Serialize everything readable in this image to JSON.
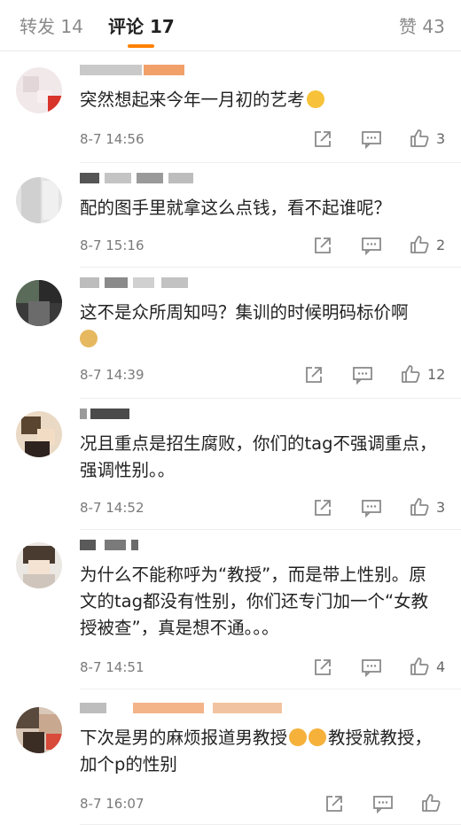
{
  "tabs": {
    "repost": "转发 14",
    "comments": "评论 17",
    "likes": "赞 43"
  },
  "accent_color": "#ff8200",
  "comments": [
    {
      "text": "突然想起来今年一月初的艺考",
      "time": "8-7 14:56",
      "likes": "3",
      "emoji": "yum-face-emoji"
    },
    {
      "text": "配的图手里就拿这么点钱，看不起谁呢？",
      "time": "8-7 15:16",
      "likes": "2"
    },
    {
      "text": "这不是众所周知吗？集训的时候明码标价啊",
      "time": "8-7 14:39",
      "likes": "12",
      "emoji": "dog-face-emoji"
    },
    {
      "text": "况且重点是招生腐败，你们的tag不强调重点，强调性别。。",
      "time": "8-7 14:52",
      "likes": "3"
    },
    {
      "text": "为什么不能称呼为“教授”，而是带上性别。原文的tag都没有性别，你们还专门加一个“女教授被查”，真是想不通。。。",
      "time": "8-7 14:51",
      "likes": "4"
    },
    {
      "text_a": "下次是男的麻烦报道男教授",
      "text_b": "教授就教授，加个p的性别",
      "time": "8-7 16:07",
      "likes": "",
      "emoji": "kiss-face-emoji"
    }
  ]
}
